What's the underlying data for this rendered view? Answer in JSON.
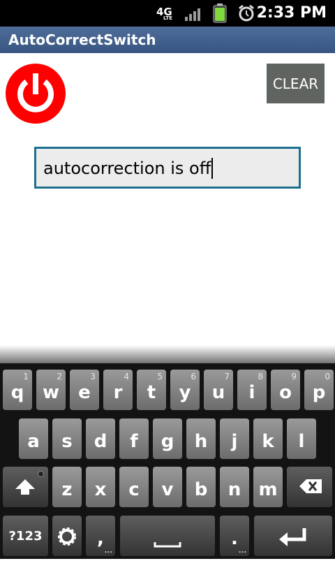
{
  "status": {
    "time": "2:33 PM",
    "network": "4G",
    "network_sub": "LTE"
  },
  "app": {
    "title": "AutoCorrectSwitch"
  },
  "controls": {
    "clear_label": "CLEAR",
    "text_value": "autocorrection is off"
  },
  "keyboard": {
    "row1": [
      {
        "k": "q",
        "h": "1"
      },
      {
        "k": "w",
        "h": "2"
      },
      {
        "k": "e",
        "h": "3"
      },
      {
        "k": "r",
        "h": "4"
      },
      {
        "k": "t",
        "h": "5"
      },
      {
        "k": "y",
        "h": "6"
      },
      {
        "k": "u",
        "h": "7"
      },
      {
        "k": "i",
        "h": "8"
      },
      {
        "k": "o",
        "h": "9"
      },
      {
        "k": "p",
        "h": "0"
      }
    ],
    "row2": [
      "a",
      "s",
      "d",
      "f",
      "g",
      "h",
      "j",
      "k",
      "l"
    ],
    "row3": [
      "z",
      "x",
      "c",
      "v",
      "b",
      "n",
      "m"
    ],
    "sym_label": "?123",
    "comma": ",",
    "period": "."
  },
  "colors": {
    "accent": "#1d6f8f",
    "power": "#ff0000",
    "titlebar": "#375580"
  }
}
